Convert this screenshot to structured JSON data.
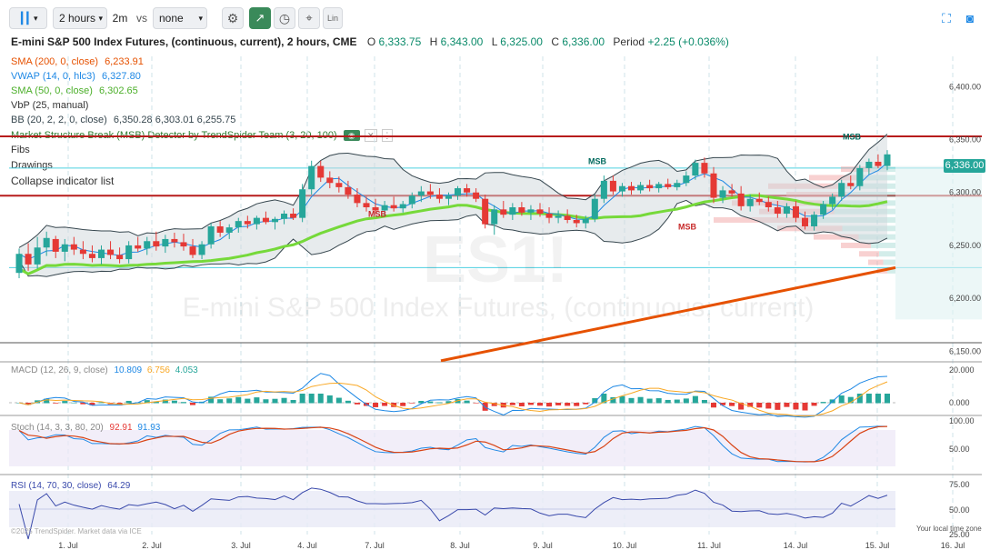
{
  "toolbar": {
    "interval": "2 hours",
    "interval2": "2m",
    "vs_label": "vs",
    "compare": "none",
    "lin_label": "Lin"
  },
  "header": {
    "title": "E-mini S&P 500 Index Futures, (continuous, current), 2 hours, CME",
    "o_label": "O",
    "o_value": "6,333.75",
    "h_label": "H",
    "h_value": "6,343.00",
    "l_label": "L",
    "l_value": "6,325.00",
    "c_label": "C",
    "c_value": "6,336.00",
    "period_label": "Period",
    "period_value": "+2.25 (+0.036%)"
  },
  "indicators": {
    "sma200_label": "SMA (200, 0, close)",
    "sma200_value": "6,233.91",
    "vwap_label": "VWAP (14, 0, hlc3)",
    "vwap_value": "6,327.80",
    "sma50_label": "SMA (50, 0, close)",
    "sma50_value": "6,302.65",
    "vbp_label": "VbP (25, manual)",
    "bb_label": "BB (20, 2, 2, 0, close)",
    "bb_values": "6,350.28  6,303.01  6,255.75",
    "msb_label": "Market Structure Break (MSB) Detector by TrendSpider Team (3, 20, 100)",
    "fibs_label": "Fibs",
    "drawings_label": "Drawings",
    "collapse_label": "Collapse indicator list"
  },
  "watermark": {
    "symbol": "ES1!",
    "name": "E-mini S&P 500 Index Futures, (continuous, current)"
  },
  "price_badge": "6,336.00",
  "msb_labels": [
    "MSB",
    "MSB",
    "MSB",
    "MSB"
  ],
  "macd": {
    "label": "MACD (12, 26, 9, close)",
    "v1": "10.809",
    "v2": "6.756",
    "v3": "4.053"
  },
  "stoch": {
    "label": "Stoch (14, 3, 3, 80, 20)",
    "v1": "92.91",
    "v2": "91.93"
  },
  "rsi": {
    "label": "RSI (14, 70, 30, close)",
    "v1": "64.29"
  },
  "footer": {
    "copyright": "©2025 TrendSpider. Market data via ICE",
    "local_time": "Your local time zone"
  },
  "colors": {
    "up": "#26a69a",
    "down": "#e53935",
    "sma200": "#e65100",
    "sma50": "#76d93a",
    "vwap": "#1e88e5",
    "bb": "#37474f",
    "res": "#b71c1c",
    "macd": "#1e88e5",
    "signal": "#f9a825",
    "rsi": "#3949ab"
  },
  "chart_data": {
    "type": "candlestick",
    "x_ticks": [
      "1. Jul",
      "2. Jul",
      "3. Jul",
      "4. Jul",
      "7. Jul",
      "8. Jul",
      "9. Jul",
      "10. Jul",
      "11. Jul",
      "14. Jul",
      "15. Jul",
      "16. Jul"
    ],
    "price_axis": {
      "ticks": [
        "6,400.00",
        "6,350.00",
        "6,300.00",
        "6,250.00",
        "6,200.00",
        "6,150.00"
      ],
      "range": [
        6140,
        6420
      ]
    },
    "macd_axis": {
      "ticks": [
        "20.000",
        "0.000"
      ]
    },
    "stoch_axis": {
      "ticks": [
        "100.00",
        "50.00"
      ]
    },
    "rsi_axis": {
      "ticks": [
        "75.00",
        "50.00",
        "25.00"
      ]
    },
    "horizontal_levels": {
      "resistance": [
        6353,
        6297
      ],
      "fib": [
        6323,
        6229
      ]
    },
    "candles": [
      {
        "o": 6224,
        "h": 6247,
        "l": 6219,
        "c": 6242
      },
      {
        "o": 6242,
        "h": 6252,
        "l": 6226,
        "c": 6232
      },
      {
        "o": 6232,
        "h": 6258,
        "l": 6228,
        "c": 6248
      },
      {
        "o": 6248,
        "h": 6263,
        "l": 6240,
        "c": 6257
      },
      {
        "o": 6256,
        "h": 6259,
        "l": 6238,
        "c": 6244
      },
      {
        "o": 6244,
        "h": 6256,
        "l": 6235,
        "c": 6251
      },
      {
        "o": 6251,
        "h": 6258,
        "l": 6241,
        "c": 6246
      },
      {
        "o": 6246,
        "h": 6254,
        "l": 6237,
        "c": 6242
      },
      {
        "o": 6242,
        "h": 6250,
        "l": 6234,
        "c": 6238
      },
      {
        "o": 6238,
        "h": 6250,
        "l": 6232,
        "c": 6246
      },
      {
        "o": 6246,
        "h": 6254,
        "l": 6237,
        "c": 6241
      },
      {
        "o": 6241,
        "h": 6248,
        "l": 6233,
        "c": 6237
      },
      {
        "o": 6237,
        "h": 6254,
        "l": 6233,
        "c": 6250
      },
      {
        "o": 6250,
        "h": 6258,
        "l": 6244,
        "c": 6247
      },
      {
        "o": 6247,
        "h": 6258,
        "l": 6241,
        "c": 6254
      },
      {
        "o": 6254,
        "h": 6263,
        "l": 6245,
        "c": 6249
      },
      {
        "o": 6249,
        "h": 6260,
        "l": 6243,
        "c": 6256
      },
      {
        "o": 6256,
        "h": 6262,
        "l": 6248,
        "c": 6253
      },
      {
        "o": 6253,
        "h": 6261,
        "l": 6245,
        "c": 6249
      },
      {
        "o": 6249,
        "h": 6256,
        "l": 6238,
        "c": 6241
      },
      {
        "o": 6241,
        "h": 6254,
        "l": 6237,
        "c": 6251
      },
      {
        "o": 6251,
        "h": 6271,
        "l": 6247,
        "c": 6268
      },
      {
        "o": 6268,
        "h": 6273,
        "l": 6258,
        "c": 6262
      },
      {
        "o": 6262,
        "h": 6270,
        "l": 6256,
        "c": 6267
      },
      {
        "o": 6267,
        "h": 6276,
        "l": 6262,
        "c": 6273
      },
      {
        "o": 6273,
        "h": 6278,
        "l": 6266,
        "c": 6270
      },
      {
        "o": 6270,
        "h": 6278,
        "l": 6265,
        "c": 6276
      },
      {
        "o": 6276,
        "h": 6282,
        "l": 6270,
        "c": 6272
      },
      {
        "o": 6272,
        "h": 6277,
        "l": 6265,
        "c": 6275
      },
      {
        "o": 6275,
        "h": 6283,
        "l": 6270,
        "c": 6280
      },
      {
        "o": 6280,
        "h": 6285,
        "l": 6274,
        "c": 6276
      },
      {
        "o": 6276,
        "h": 6308,
        "l": 6272,
        "c": 6303
      },
      {
        "o": 6303,
        "h": 6330,
        "l": 6298,
        "c": 6325
      },
      {
        "o": 6325,
        "h": 6330,
        "l": 6310,
        "c": 6314
      },
      {
        "o": 6314,
        "h": 6320,
        "l": 6304,
        "c": 6309
      },
      {
        "o": 6309,
        "h": 6315,
        "l": 6300,
        "c": 6305
      },
      {
        "o": 6305,
        "h": 6311,
        "l": 6294,
        "c": 6298
      },
      {
        "o": 6298,
        "h": 6304,
        "l": 6286,
        "c": 6290
      },
      {
        "o": 6290,
        "h": 6296,
        "l": 6282,
        "c": 6286
      },
      {
        "o": 6286,
        "h": 6294,
        "l": 6279,
        "c": 6283
      },
      {
        "o": 6283,
        "h": 6292,
        "l": 6278,
        "c": 6288
      },
      {
        "o": 6288,
        "h": 6296,
        "l": 6282,
        "c": 6285
      },
      {
        "o": 6285,
        "h": 6292,
        "l": 6281,
        "c": 6289
      },
      {
        "o": 6289,
        "h": 6300,
        "l": 6285,
        "c": 6297
      },
      {
        "o": 6297,
        "h": 6306,
        "l": 6291,
        "c": 6301
      },
      {
        "o": 6301,
        "h": 6308,
        "l": 6294,
        "c": 6298
      },
      {
        "o": 6298,
        "h": 6304,
        "l": 6290,
        "c": 6294
      },
      {
        "o": 6294,
        "h": 6300,
        "l": 6288,
        "c": 6297
      },
      {
        "o": 6297,
        "h": 6306,
        "l": 6293,
        "c": 6304
      },
      {
        "o": 6304,
        "h": 6308,
        "l": 6296,
        "c": 6300
      },
      {
        "o": 6300,
        "h": 6304,
        "l": 6291,
        "c": 6294
      },
      {
        "o": 6294,
        "h": 6298,
        "l": 6266,
        "c": 6270
      },
      {
        "o": 6270,
        "h": 6288,
        "l": 6260,
        "c": 6284
      },
      {
        "o": 6284,
        "h": 6292,
        "l": 6276,
        "c": 6279
      },
      {
        "o": 6279,
        "h": 6290,
        "l": 6274,
        "c": 6286
      },
      {
        "o": 6286,
        "h": 6291,
        "l": 6278,
        "c": 6281
      },
      {
        "o": 6281,
        "h": 6288,
        "l": 6274,
        "c": 6284
      },
      {
        "o": 6284,
        "h": 6290,
        "l": 6277,
        "c": 6280
      },
      {
        "o": 6280,
        "h": 6286,
        "l": 6271,
        "c": 6276
      },
      {
        "o": 6276,
        "h": 6283,
        "l": 6271,
        "c": 6278
      },
      {
        "o": 6278,
        "h": 6284,
        "l": 6271,
        "c": 6274
      },
      {
        "o": 6274,
        "h": 6279,
        "l": 6267,
        "c": 6271
      },
      {
        "o": 6271,
        "h": 6278,
        "l": 6266,
        "c": 6275
      },
      {
        "o": 6275,
        "h": 6298,
        "l": 6272,
        "c": 6294
      },
      {
        "o": 6294,
        "h": 6316,
        "l": 6290,
        "c": 6311
      },
      {
        "o": 6311,
        "h": 6316,
        "l": 6298,
        "c": 6301
      },
      {
        "o": 6301,
        "h": 6309,
        "l": 6296,
        "c": 6306
      },
      {
        "o": 6306,
        "h": 6310,
        "l": 6298,
        "c": 6302
      },
      {
        "o": 6302,
        "h": 6310,
        "l": 6299,
        "c": 6307
      },
      {
        "o": 6307,
        "h": 6312,
        "l": 6301,
        "c": 6304
      },
      {
        "o": 6304,
        "h": 6310,
        "l": 6300,
        "c": 6308
      },
      {
        "o": 6308,
        "h": 6313,
        "l": 6303,
        "c": 6305
      },
      {
        "o": 6305,
        "h": 6312,
        "l": 6302,
        "c": 6309
      },
      {
        "o": 6309,
        "h": 6320,
        "l": 6306,
        "c": 6316
      },
      {
        "o": 6316,
        "h": 6331,
        "l": 6312,
        "c": 6328
      },
      {
        "o": 6328,
        "h": 6333,
        "l": 6314,
        "c": 6318
      },
      {
        "o": 6318,
        "h": 6324,
        "l": 6290,
        "c": 6295
      },
      {
        "o": 6295,
        "h": 6306,
        "l": 6290,
        "c": 6302
      },
      {
        "o": 6302,
        "h": 6308,
        "l": 6296,
        "c": 6299
      },
      {
        "o": 6299,
        "h": 6306,
        "l": 6283,
        "c": 6287
      },
      {
        "o": 6287,
        "h": 6298,
        "l": 6282,
        "c": 6294
      },
      {
        "o": 6294,
        "h": 6300,
        "l": 6288,
        "c": 6291
      },
      {
        "o": 6291,
        "h": 6296,
        "l": 6282,
        "c": 6286
      },
      {
        "o": 6286,
        "h": 6292,
        "l": 6276,
        "c": 6280
      },
      {
        "o": 6280,
        "h": 6290,
        "l": 6276,
        "c": 6287
      },
      {
        "o": 6287,
        "h": 6292,
        "l": 6272,
        "c": 6276
      },
      {
        "o": 6276,
        "h": 6282,
        "l": 6265,
        "c": 6268
      },
      {
        "o": 6268,
        "h": 6282,
        "l": 6264,
        "c": 6279
      },
      {
        "o": 6279,
        "h": 6292,
        "l": 6275,
        "c": 6289
      },
      {
        "o": 6289,
        "h": 6299,
        "l": 6284,
        "c": 6296
      },
      {
        "o": 6296,
        "h": 6312,
        "l": 6292,
        "c": 6309
      },
      {
        "o": 6309,
        "h": 6316,
        "l": 6303,
        "c": 6306
      },
      {
        "o": 6306,
        "h": 6326,
        "l": 6302,
        "c": 6323
      },
      {
        "o": 6323,
        "h": 6332,
        "l": 6317,
        "c": 6329
      },
      {
        "o": 6329,
        "h": 6336,
        "l": 6323,
        "c": 6325
      },
      {
        "o": 6325,
        "h": 6340,
        "l": 6321,
        "c": 6336
      }
    ]
  }
}
